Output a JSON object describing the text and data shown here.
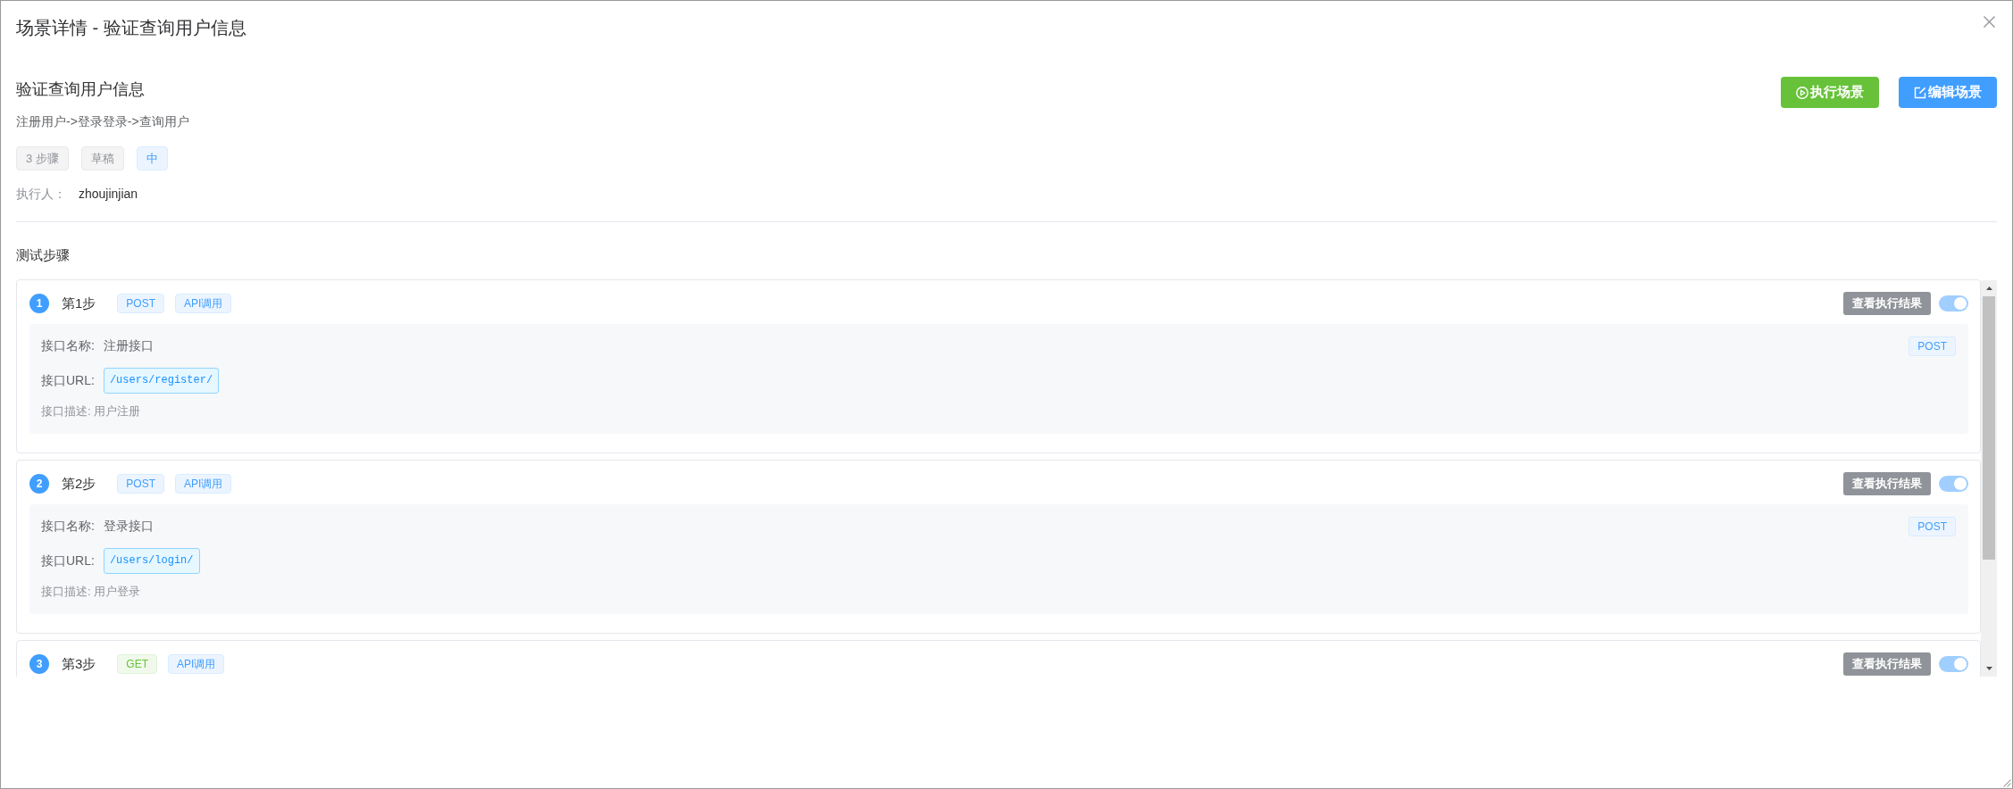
{
  "dialog": {
    "title": "场景详情 - 验证查询用户信息"
  },
  "scenario": {
    "name": "验证查询用户信息",
    "description": "注册用户->登录登录->查询用户",
    "tags": [
      {
        "text": "3 步骤",
        "kind": "info"
      },
      {
        "text": "草稿",
        "kind": "info"
      },
      {
        "text": "中",
        "kind": "primary"
      }
    ],
    "executor_label": "执行人：",
    "executor": "zhoujinjian"
  },
  "actions": [
    {
      "label": "执行场景",
      "kind": "run"
    },
    {
      "label": "编辑场景",
      "kind": "edit"
    }
  ],
  "steps_section": {
    "title": "测试步骤",
    "steps": [
      {
        "number": "1",
        "title": "第1步",
        "method_tag": {
          "text": "POST",
          "kind": "primary"
        },
        "type_tag": "API调用",
        "result_button": "查看执行结果",
        "on": true,
        "details": {
          "name_label": "接口名称:",
          "name": "注册接口",
          "method_badge": "POST",
          "url_label": "接口URL:",
          "url": "/users/register/",
          "description": "接口描述: 用户注册"
        }
      },
      {
        "number": "2",
        "title": "第2步",
        "method_tag": {
          "text": "POST",
          "kind": "primary"
        },
        "type_tag": "API调用",
        "result_button": "查看执行结果",
        "on": true,
        "details": {
          "name_label": "接口名称:",
          "name": "登录接口",
          "method_badge": "POST",
          "url_label": "接口URL:",
          "url": "/users/login/",
          "description": "接口描述: 用户登录"
        }
      },
      {
        "number": "3",
        "title": "第3步",
        "method_tag": {
          "text": "GET",
          "kind": "success"
        },
        "type_tag": "API调用",
        "result_button": "查看执行结果",
        "on": true
      }
    ]
  }
}
